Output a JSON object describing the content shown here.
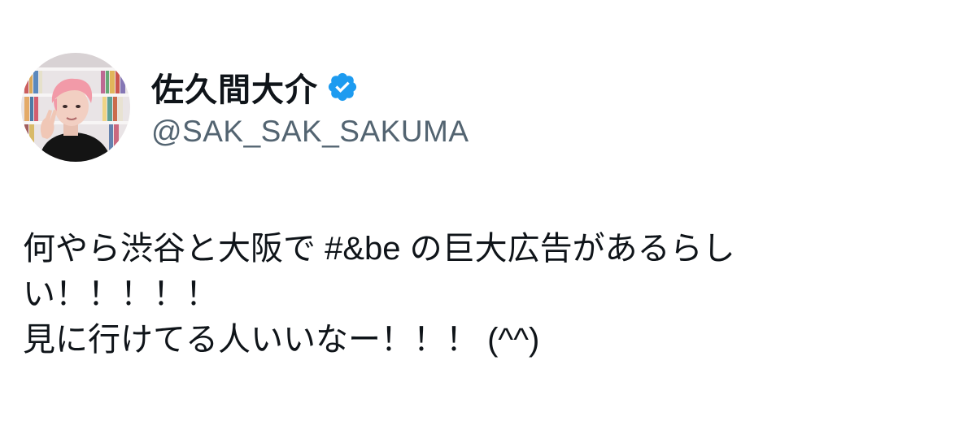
{
  "author": {
    "display_name": "佐久間大介",
    "handle": "@SAK_SAK_SAKUMA",
    "verified": true,
    "verified_color": "#1d9bf0"
  },
  "tweet": {
    "line1_before": "何やら渋谷と大阪で ",
    "hashtag": "#&be",
    "line1_after": " の巨大広告があるらし",
    "line2": "い！！！！！",
    "line3": "見に行けてる人いいなー！！！ (^^)"
  },
  "colors": {
    "text": "#0f1419",
    "secondary": "#536471",
    "background": "#ffffff"
  }
}
